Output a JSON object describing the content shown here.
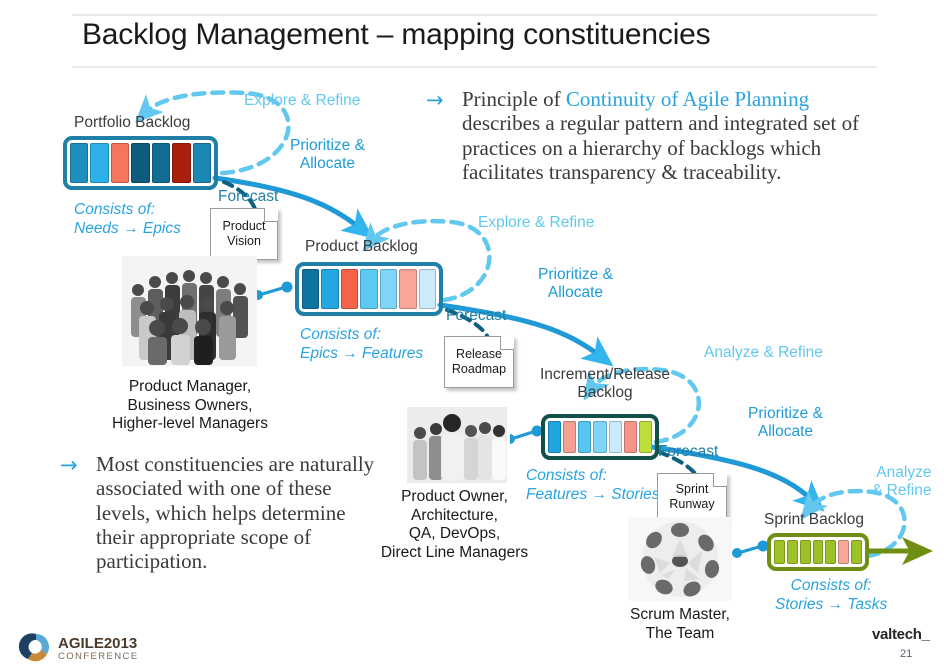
{
  "slide": {
    "title": "Backlog Management – mapping constituencies",
    "page_number": "21",
    "footer_logo_text": "AGILE2013",
    "footer_logo_sub": "CONFERENCE",
    "vendor_logo": "valtech_"
  },
  "prose": {
    "principle": {
      "lead": "Principle of ",
      "highlight": "Continuity of Agile Planning",
      "rest": " describes a regular pattern and integrated set of practices on a hierarchy of backlogs which facilitates transparency & traceability.",
      "bullet_arrow": "→"
    },
    "constituencies": {
      "text": "Most constituencies are naturally associated with one of these levels, which helps determine their appropriate scope of participation.",
      "bullet_arrow": "→"
    }
  },
  "backlogs": [
    {
      "id": "portfolio",
      "label": "Portfolio Backlog",
      "consists_line1": "Consists of:",
      "consists_line2": "Needs → Epics",
      "border_color": "#1f7fa6",
      "cells": [
        "#1f8fbf",
        "#2bb0e8",
        "#f4765d",
        "#0d5c7d",
        "#116e92",
        "#a81f0c",
        "#1a87b4"
      ]
    },
    {
      "id": "product",
      "label": "Product Backlog",
      "consists_line1": "Consists of:",
      "consists_line2": "Epics → Features",
      "border_color": "#1f7fa6",
      "cells": [
        "#0f74a0",
        "#22a7e0",
        "#f4634a",
        "#5ec8f4",
        "#7fd5f7",
        "#f9a699",
        "#cbeafb"
      ]
    },
    {
      "id": "increment",
      "label": "Increment/Release Backlog",
      "consists_line1": "Consists of:",
      "consists_line2": "Features → Stories",
      "border_color": "#12504a",
      "cells": [
        "#1fa5e0",
        "#f6a094",
        "#57c6f2",
        "#7fd5f7",
        "#cbeafb",
        "#f6948a",
        "#bede3a"
      ]
    },
    {
      "id": "sprint",
      "label": "Sprint Backlog",
      "consists_line1": "Consists of:",
      "consists_line2": "Stories → Tasks",
      "border_color": "#6f8f14",
      "cells": [
        "#9dc227",
        "#9dc227",
        "#9dc227",
        "#9dc227",
        "#9dc227",
        "#f8a79b",
        "#9dc227"
      ]
    }
  ],
  "cycle_labels": {
    "explore_refine_1": "Explore & Refine",
    "explore_refine_2": "Explore & Refine",
    "analyze_refine_1": "Analyze & Refine",
    "analyze_refine_2_line1": "Analyze",
    "analyze_refine_2_line2": "& Refine",
    "prioritize_1_line1": "Prioritize &",
    "prioritize_1_line2": "Allocate",
    "prioritize_2_line1": "Prioritize &",
    "prioritize_2_line2": "Allocate",
    "prioritize_3_line1": "Prioritize &",
    "prioritize_3_line2": "Allocate",
    "forecast_1": "Forecast",
    "forecast_2": "Forecast",
    "forecast_3": "Forecast"
  },
  "artifacts": [
    {
      "id": "product-vision",
      "line1": "Product",
      "line2": "Vision"
    },
    {
      "id": "release-roadmap",
      "line1": "Release",
      "line2": "Roadmap"
    },
    {
      "id": "sprint-runway",
      "line1": "Sprint",
      "line2": "Runway"
    }
  ],
  "constituency_groups": [
    {
      "id": "managers",
      "caption_lines": [
        "Product Manager,",
        "Business Owners,",
        "Higher-level Managers"
      ]
    },
    {
      "id": "product-owner",
      "caption_lines": [
        "Product Owner,",
        "Architecture,",
        "QA, DevOps,",
        "Direct Line Managers"
      ]
    },
    {
      "id": "scrum-team",
      "caption_lines": [
        "Scrum Master,",
        "The Team"
      ]
    }
  ],
  "colors": {
    "accent_blue": "#29a3e0",
    "light_blue": "#62c8ef",
    "deep_blue": "#1f7fa6",
    "olive": "#6f8f14",
    "text_dark": "#3b3b3b"
  }
}
